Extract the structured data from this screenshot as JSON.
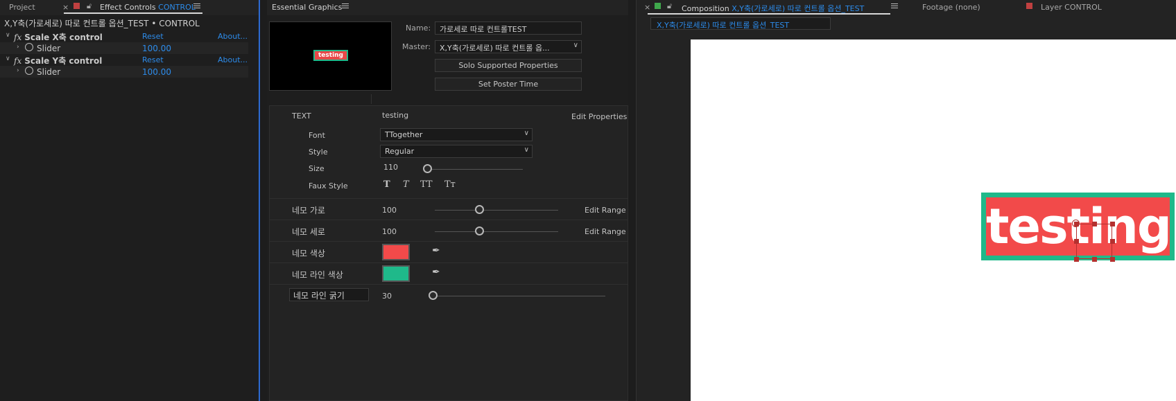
{
  "colors": {
    "accent_blue": "#2d8ceb",
    "box_fill": "#f24a4a",
    "box_line": "#1fb98a",
    "panel_bg": "#1e1e1e"
  },
  "effect_controls": {
    "tab_project": "Project",
    "tab_effect_controls": "Effect Controls",
    "tab_effect_controls_layer": "CONTROL",
    "breadcrumb": "X,Y축(가로세로) 따로 컨트롤 옵션_TEST • CONTROL",
    "effects": [
      {
        "name": "Scale X축 control",
        "reset": "Reset",
        "about": "About...",
        "param": "Slider",
        "value": "100.00"
      },
      {
        "name": "Scale Y축 control",
        "reset": "Reset",
        "about": "About...",
        "param": "Slider",
        "value": "100.00"
      }
    ]
  },
  "essential_graphics": {
    "title": "Essential Graphics",
    "thumb_text": "testing",
    "name_label": "Name:",
    "name_value": "가로세로 따로 컨트롤TEST",
    "master_label": "Master:",
    "master_value": "X,Y축(가로세로) 따로 컨트롤 옵...",
    "solo_button": "Solo Supported Properties",
    "poster_button": "Set Poster Time",
    "text_section": {
      "label": "TEXT",
      "value": "testing",
      "edit_properties": "Edit Properties",
      "font_label": "Font",
      "font_value": "TTogether",
      "style_label": "Style",
      "style_value": "Regular",
      "size_label": "Size",
      "size_value": "110",
      "faux_label": "Faux Style",
      "faux_glyphs": [
        "T",
        "T",
        "TT",
        "Tт"
      ]
    },
    "rows": [
      {
        "label": "네모 가로",
        "value": "100",
        "link": "Edit Range"
      },
      {
        "label": "네모 세로",
        "value": "100",
        "link": "Edit Range"
      },
      {
        "label": "네모 색상"
      },
      {
        "label": "네모 라인 색상"
      },
      {
        "label": "네모 라인 굵기",
        "value": "30"
      }
    ]
  },
  "composition": {
    "tab_comp_prefix": "Composition",
    "tab_comp_name": "X,Y축(가로세로) 따로 컨트롤 옵션_TEST",
    "tab_footage": "Footage (none)",
    "tab_layer": "Layer CONTROL",
    "subtab": "X,Y축(가로세로) 따로 컨트롤 옵션_TEST",
    "preview_text": "testing"
  }
}
